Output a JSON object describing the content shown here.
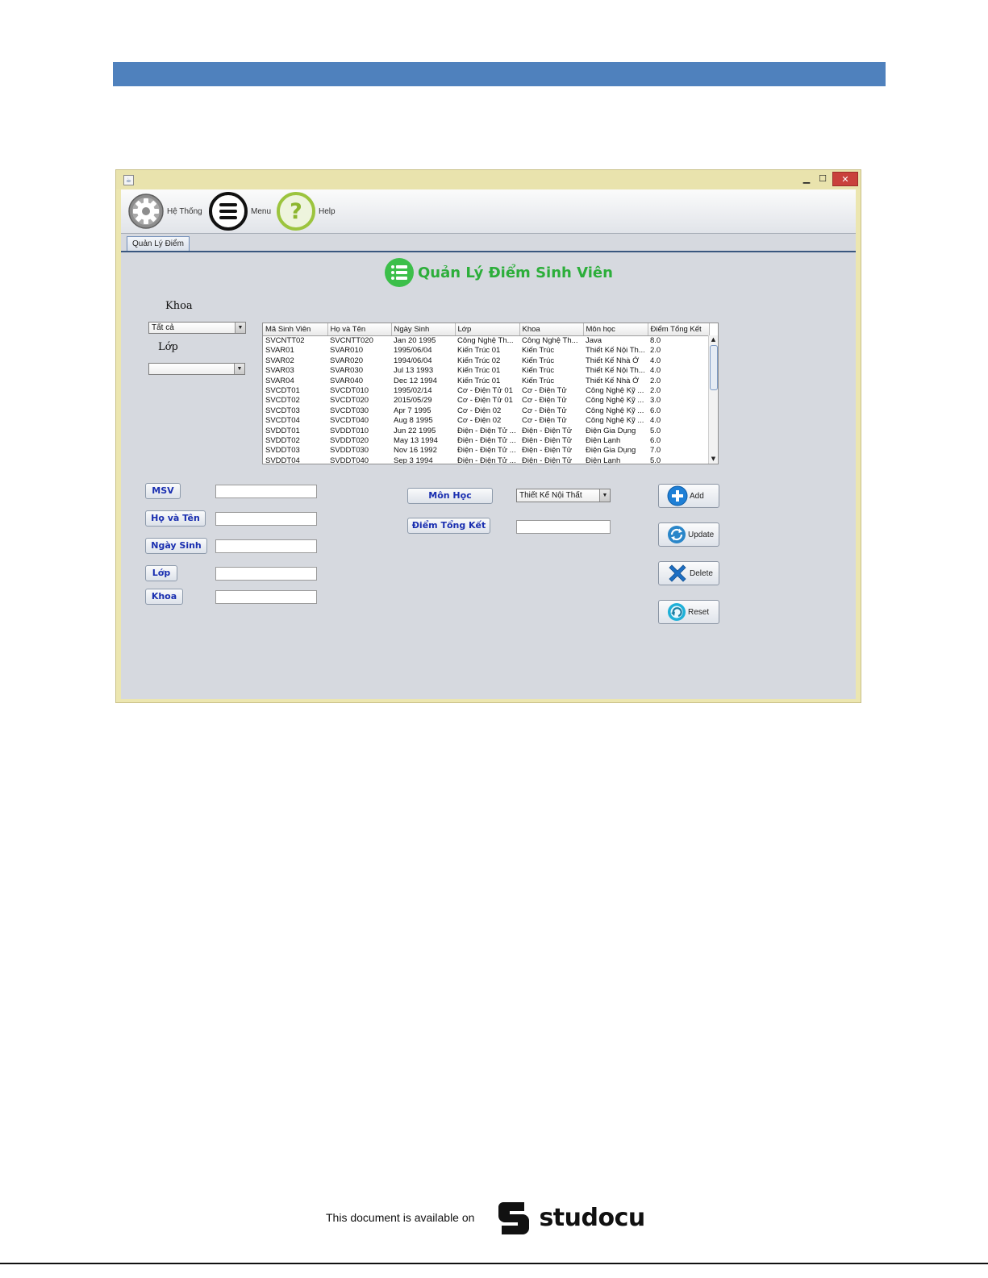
{
  "toolbar": {
    "he_thong_label": "Hệ Thống",
    "menu_label": "Menu",
    "help_label": "Help"
  },
  "tab": {
    "label": "Quản Lý Điểm"
  },
  "heading": {
    "title": "Quản Lý Điểm Sinh Viên"
  },
  "filters": {
    "khoa_label": "Khoa",
    "khoa_value": "Tất cả",
    "lop_label": "Lớp",
    "lop_value": ""
  },
  "table": {
    "columns": [
      "Mã Sinh Viên",
      "Họ và Tên",
      "Ngày Sinh",
      "Lớp",
      "Khoa",
      "Môn học",
      "Điểm Tổng Kết"
    ],
    "rows": [
      [
        "SVCNTT02",
        "SVCNTT020",
        "Jan 20 1995",
        "Công Nghệ Th...",
        "Công Nghệ Th...",
        "Java",
        "8.0"
      ],
      [
        "SVAR01",
        "SVAR010",
        "1995/06/04",
        "Kiến Trúc 01",
        "Kiến Trúc",
        "Thiết Kế Nội Th...",
        "2.0"
      ],
      [
        "SVAR02",
        "SVAR020",
        "1994/06/04",
        "Kiến Trúc 02",
        "Kiến Trúc",
        "Thiết Kế Nhà Ở",
        "4.0"
      ],
      [
        "SVAR03",
        "SVAR030",
        "Jul 13 1993",
        "Kiến Trúc 01",
        "Kiến Trúc",
        "Thiết Kế Nội Th...",
        "4.0"
      ],
      [
        "SVAR04",
        "SVAR040",
        "Dec 12 1994",
        "Kiến Trúc 01",
        "Kiến Trúc",
        "Thiết Kế Nhà Ở",
        "2.0"
      ],
      [
        "SVCDT01",
        "SVCDT010",
        "1995/02/14",
        "Cơ - Điện Tử 01",
        "Cơ - Điện Tử",
        "Công Nghệ Kỹ ...",
        "2.0"
      ],
      [
        "SVCDT02",
        "SVCDT020",
        "2015/05/29",
        "Cơ - Điện Tử 01",
        "Cơ - Điện Tử",
        "Công Nghệ Kỹ ...",
        "3.0"
      ],
      [
        "SVCDT03",
        "SVCDT030",
        "Apr 7 1995",
        "Cơ - Điện 02",
        "Cơ - Điện Tử",
        "Công Nghệ Kỹ ...",
        "6.0"
      ],
      [
        "SVCDT04",
        "SVCDT040",
        "Aug 8 1995",
        "Cơ - Điện 02",
        "Cơ - Điện Tử",
        "Công Nghệ Kỹ ...",
        "4.0"
      ],
      [
        "SVDDT01",
        "SVDDT010",
        "Jun 22 1995",
        "Điện - Điện Tử ...",
        "Điện - Điện Tử",
        "Điện Gia Dụng",
        "5.0"
      ],
      [
        "SVDDT02",
        "SVDDT020",
        "May 13 1994",
        "Điện - Điện Tử ...",
        "Điện - Điện Tử",
        "Điện Lạnh",
        "6.0"
      ],
      [
        "SVDDT03",
        "SVDDT030",
        "Nov 16 1992",
        "Điện - Điện Tử ...",
        "Điện - Điện Tử",
        "Điện Gia Dụng",
        "7.0"
      ],
      [
        "SVDDT04",
        "SVDDT040",
        "Sep 3 1994",
        "Điện - Điện Tử ...",
        "Điện - Điện Tử",
        "Điện Lạnh",
        "5.0"
      ]
    ]
  },
  "form": {
    "msv_label": "MSV",
    "ho_ten_label": "Họ và Tên",
    "ngay_sinh_label": "Ngày Sinh",
    "lop_label": "Lớp",
    "khoa_label": "Khoa",
    "mon_hoc_label": "Môn Học",
    "mon_hoc_value": "Thiết Kế Nội Thất",
    "diem_label": "Điểm Tổng Kết"
  },
  "actions": {
    "add_label": "Add",
    "update_label": "Update",
    "delete_label": "Delete",
    "reset_label": "Reset"
  },
  "footer": {
    "note": "This document is available on",
    "brand": "studocu"
  },
  "colors": {
    "header_band": "#4f81bd",
    "heading_green": "#2cae3a",
    "label_blue": "#1a2fb0",
    "close_red": "#c9413c"
  },
  "icons": {
    "he_thong": "gear-icon",
    "menu": "menu-icon",
    "help": "help-icon",
    "heading": "list-icon",
    "add": "plus-icon",
    "update": "refresh-icon",
    "delete": "x-icon",
    "reset": "reset-icon"
  }
}
